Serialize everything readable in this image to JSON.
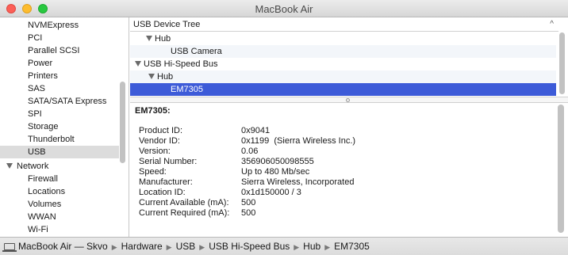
{
  "window": {
    "title": "MacBook Air"
  },
  "sidebar": {
    "items": [
      {
        "label": "NVMExpress",
        "kind": "child"
      },
      {
        "label": "PCI",
        "kind": "child"
      },
      {
        "label": "Parallel SCSI",
        "kind": "child"
      },
      {
        "label": "Power",
        "kind": "child"
      },
      {
        "label": "Printers",
        "kind": "child"
      },
      {
        "label": "SAS",
        "kind": "child"
      },
      {
        "label": "SATA/SATA Express",
        "kind": "child"
      },
      {
        "label": "SPI",
        "kind": "child"
      },
      {
        "label": "Storage",
        "kind": "child"
      },
      {
        "label": "Thunderbolt",
        "kind": "child"
      },
      {
        "label": "USB",
        "kind": "child",
        "selected": true
      },
      {
        "label": "Network",
        "kind": "group"
      },
      {
        "label": "Firewall",
        "kind": "child"
      },
      {
        "label": "Locations",
        "kind": "child"
      },
      {
        "label": "Volumes",
        "kind": "child"
      },
      {
        "label": "WWAN",
        "kind": "child"
      },
      {
        "label": "Wi-Fi",
        "kind": "child"
      }
    ]
  },
  "tree": {
    "header": "USB Device Tree",
    "rows": [
      {
        "label": "Hub",
        "expanded": true
      },
      {
        "label": "USB Camera",
        "expanded": false
      },
      {
        "label": "USB Hi-Speed Bus",
        "expanded": true
      },
      {
        "label": "Hub",
        "expanded": true
      },
      {
        "label": "EM7305",
        "expanded": false,
        "selected": true
      }
    ]
  },
  "detail": {
    "title": "EM7305:",
    "fields": [
      {
        "key": "Product ID:",
        "value": "0x9041"
      },
      {
        "key": "Vendor ID:",
        "value": "0x1199  (Sierra Wireless Inc.)"
      },
      {
        "key": "Version:",
        "value": "0.06"
      },
      {
        "key": "Serial Number:",
        "value": "356906050098555"
      },
      {
        "key": "Speed:",
        "value": "Up to 480 Mb/sec"
      },
      {
        "key": "Manufacturer:",
        "value": "Sierra Wireless, Incorporated"
      },
      {
        "key": "Location ID:",
        "value": "0x1d150000 / 3"
      },
      {
        "key": "Current Available (mA):",
        "value": "500"
      },
      {
        "key": "Current Required (mA):",
        "value": "500"
      }
    ]
  },
  "pathbar": {
    "crumbs": [
      "MacBook Air — Skvo",
      "Hardware",
      "USB",
      "USB Hi-Speed Bus",
      "Hub",
      "EM7305"
    ]
  },
  "colors": {
    "selection": "#3d5bd8",
    "sidebar_selection": "#dcdcdc"
  }
}
